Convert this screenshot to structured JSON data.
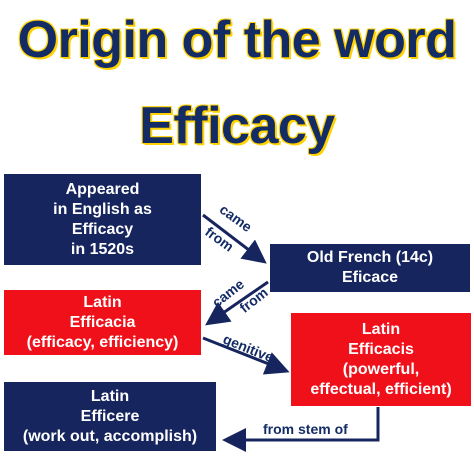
{
  "title": {
    "line1": "Origin of the word",
    "line2": "Efficacy"
  },
  "boxes": {
    "appeared": [
      "Appeared",
      "in English as",
      "Efficacy",
      "in 1520s"
    ],
    "old_french": [
      "Old French (14c)",
      "Eficace"
    ],
    "efficacia": [
      "Latin",
      "Efficacia",
      "(efficacy, efficiency)"
    ],
    "efficacis": [
      "Latin",
      "Efficacis",
      "(powerful,",
      "effectual, efficient)"
    ],
    "efficere": [
      "Latin",
      "Efficere",
      "(work out, accomplish)"
    ]
  },
  "arrow_labels": {
    "came_from_1a": "came",
    "came_from_1b": "from",
    "came_from_2a": "came",
    "came_from_2b": "from",
    "genitive": "genitive",
    "from_stem_of": "from stem of"
  },
  "colors": {
    "title_text": "#142c66",
    "title_outline": "#ffd200",
    "navy_box": "#16255e",
    "red_box": "#f0101a",
    "arrow": "#16255e"
  }
}
